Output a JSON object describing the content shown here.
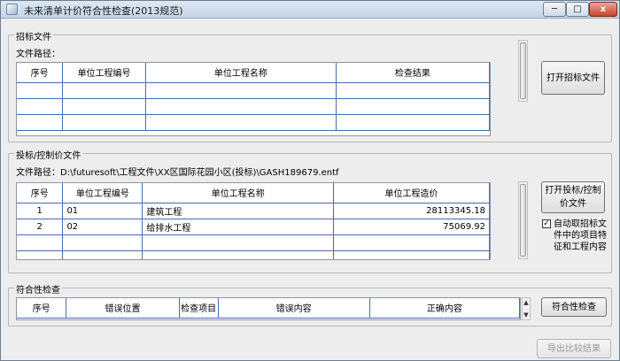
{
  "window": {
    "title": "未来清单计价符合性检查(2013规范)",
    "caption_min": "─",
    "caption_max": "□",
    "caption_close": "x"
  },
  "tender": {
    "group_title": "招标文件",
    "path_label": "文件路径：",
    "columns": [
      "序号",
      "单位工程编号",
      "单位工程名称",
      "检查结果"
    ],
    "rows": [],
    "open_button": "打开招标文件"
  },
  "bid": {
    "group_title": "投标/控制价文件",
    "path_label": "文件路径：D:\\futuresoft\\工程文件\\XX区国际花园小区(投标)\\GASH189679.entf",
    "columns": [
      "序号",
      "单位工程编号",
      "单位工程名称",
      "单位工程造价"
    ],
    "rows": [
      {
        "no": "1",
        "code": "01",
        "name": "建筑工程",
        "price": "28113345.18"
      },
      {
        "no": "2",
        "code": "02",
        "name": "给排水工程",
        "price": "75069.92"
      }
    ],
    "open_button": "打开投标/控制价文件",
    "auto_checkbox_label": "自动取招标文件中的项目特征和工程内容",
    "auto_checked": true
  },
  "check": {
    "group_title": "符合性检查",
    "columns": [
      "序号",
      "错误位置",
      "检查项目",
      "错误内容",
      "正确内容"
    ],
    "check_button": "符合性检查",
    "export_button": "导出比较结果"
  },
  "icons": {
    "app": "app-icon",
    "scroll_up": "▲",
    "scroll_down": "▼",
    "check_mark": "✓"
  }
}
